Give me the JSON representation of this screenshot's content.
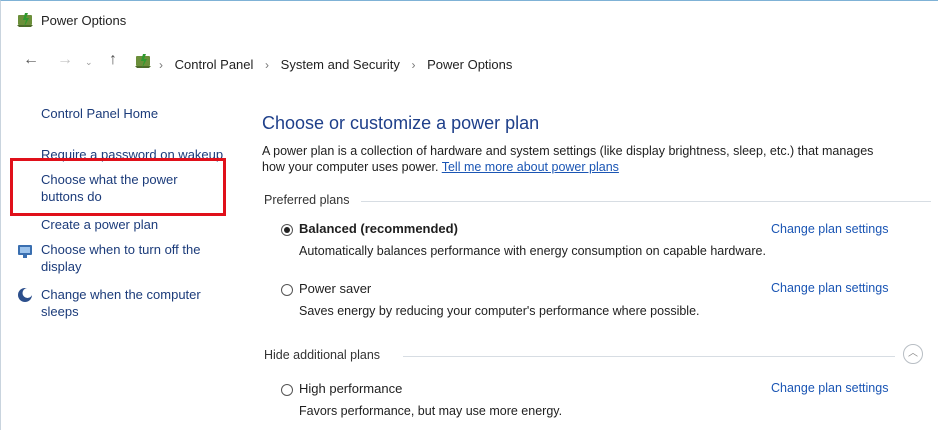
{
  "window": {
    "title": "Power Options"
  },
  "address": {
    "back_icon": "←",
    "forward_icon": "→",
    "dropdown_icon": "⌄",
    "up_icon": "↑",
    "separator": "›",
    "breadcrumbs": [
      "Control Panel",
      "System and Security",
      "Power Options"
    ]
  },
  "sidebar": {
    "home": "Control Panel Home",
    "require_password": "Require a password on wakeup",
    "choose_power_buttons_line1": "Choose what the power",
    "choose_power_buttons_line2": "buttons do",
    "create_plan": "Create a power plan",
    "turn_off_display_line1": "Choose when to turn off the",
    "turn_off_display_line2": "display",
    "computer_sleeps_line1": "Change when the computer",
    "computer_sleeps_line2": "sleeps"
  },
  "main": {
    "heading": "Choose or customize a power plan",
    "description_line1": "A power plan is a collection of hardware and system settings (like display brightness, sleep, etc.) that manages",
    "description_line2": "how your computer uses power.",
    "learn_more": "Tell me more about power plans",
    "preferred_plans_label": "Preferred plans",
    "hide_additional_plans_label": "Hide additional plans",
    "change_settings_label": "Change plan settings",
    "plans": [
      {
        "name": "Balanced (recommended)",
        "description": "Automatically balances performance with energy consumption on capable hardware.",
        "selected": true
      },
      {
        "name": "Power saver",
        "description": "Saves energy by reducing your computer's performance where possible.",
        "selected": false
      },
      {
        "name": "High performance",
        "description": "Favors performance, but may use more energy.",
        "selected": false
      }
    ]
  },
  "colors": {
    "highlight_box": "#e0101a",
    "heading": "#1e3f8a",
    "link": "#1a55b4"
  }
}
